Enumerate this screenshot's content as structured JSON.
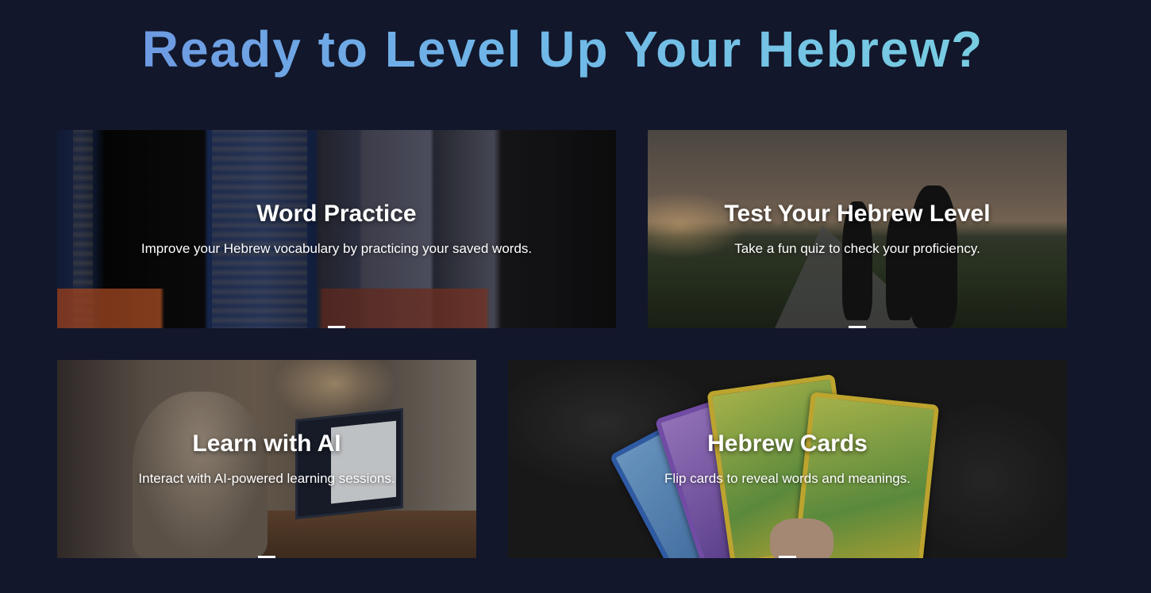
{
  "page": {
    "title": "Ready to Level Up Your Hebrew?"
  },
  "cards": [
    {
      "title": "Word Practice",
      "description": "Improve your Hebrew vocabulary by practicing your saved words.",
      "image": "books-on-shelf-photo"
    },
    {
      "title": "Test Your Hebrew Level",
      "description": "Take a fun quiz to check your proficiency.",
      "image": "cyclists-at-sunset-photo"
    },
    {
      "title": "Learn with AI",
      "description": "Interact with AI-powered learning sessions.",
      "image": "person-at-laptop-photo"
    },
    {
      "title": "Hebrew Cards",
      "description": "Flip cards to reveal words and meanings.",
      "image": "trading-cards-in-hand-photo"
    }
  ],
  "colors": {
    "background": "#12172b",
    "title_gradient_start": "#6e8fe0",
    "title_gradient_end": "#7bd4e0",
    "card_text": "#ffffff"
  }
}
